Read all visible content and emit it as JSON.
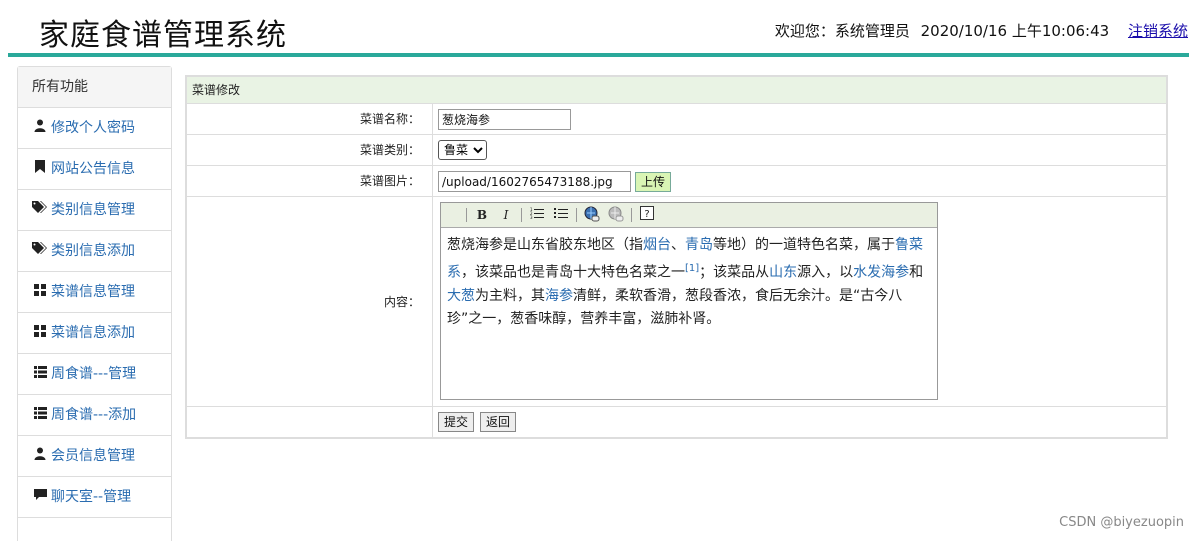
{
  "header": {
    "title": "家庭食谱管理系统",
    "welcome_text": "欢迎您：系统管理员",
    "datetime": "2020/10/16 上午10:06:43",
    "logout_label": "注销系统"
  },
  "sidebar": {
    "title": "所有功能",
    "items": [
      {
        "label": "修改个人密码",
        "icon": "user-icon"
      },
      {
        "label": "网站公告信息",
        "icon": "bookmark-icon"
      },
      {
        "label": "类别信息管理",
        "icon": "tags-icon"
      },
      {
        "label": "类别信息添加",
        "icon": "tags-icon"
      },
      {
        "label": "菜谱信息管理",
        "icon": "grid-icon"
      },
      {
        "label": "菜谱信息添加",
        "icon": "grid-icon"
      },
      {
        "label": "周食谱---管理",
        "icon": "list-icon"
      },
      {
        "label": "周食谱---添加",
        "icon": "list-icon"
      },
      {
        "label": "会员信息管理",
        "icon": "user-icon"
      },
      {
        "label": "聊天室--管理",
        "icon": "comment-icon"
      }
    ]
  },
  "form": {
    "title": "菜谱修改",
    "name_label": "菜谱名称：",
    "name_value": "葱烧海参",
    "category_label": "菜谱类别：",
    "category_value": "鲁菜",
    "image_label": "菜谱图片：",
    "image_value": "/upload/1602765473188.jpg",
    "upload_label": "上传",
    "content_label": "内容：",
    "submit_label": "提交",
    "back_label": "返回"
  },
  "editor": {
    "toolbar": [
      "bold-icon",
      "italic-icon",
      "ordered-list-icon",
      "unordered-list-icon",
      "link-icon",
      "unlink-icon",
      "help-icon"
    ],
    "content": {
      "p1": "葱烧海参是山东省胶东地区（指",
      "l1": "烟台",
      "p2": "、",
      "l2": "青岛",
      "p3": "等地）的一道特色名菜，属于",
      "l3": "鲁菜系",
      "p4": "，该菜品也是青岛十大特色名菜之一",
      "ref": "[1]",
      "p5": "；该菜品从",
      "l4": "山东",
      "p6": "源入，以",
      "l5": "水发海参",
      "p7": "和",
      "l6": "大葱",
      "p8": "为主料，其",
      "l7": "海参",
      "p9": "清鲜，柔软香滑，葱段香浓，食后无余汁。是“古今八珍”之一，葱香味醇，营养丰富，滋肺补肾。"
    }
  },
  "watermark": "CSDN @biyezuopin"
}
